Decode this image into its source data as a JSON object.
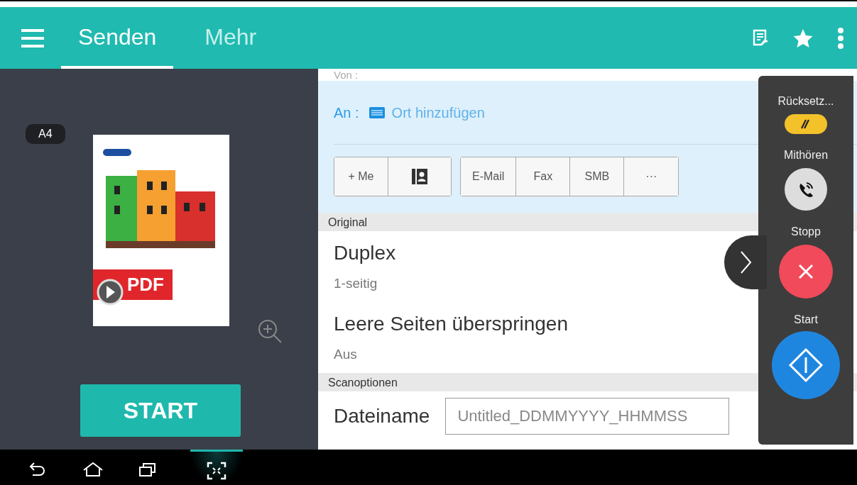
{
  "header": {
    "tabs": [
      {
        "label": "Senden",
        "selected": true
      },
      {
        "label": "Mehr",
        "selected": false
      }
    ],
    "actions": [
      {
        "kind": "document"
      },
      {
        "kind": "star"
      },
      {
        "kind": "more"
      }
    ]
  },
  "preview": {
    "paper_size": "A4",
    "format_badge": "PDF",
    "start_button": "START"
  },
  "form": {
    "from_label": "Von :",
    "to": {
      "label": "An :",
      "link": "Ort hinzufügen"
    },
    "button_groups": [
      [
        {
          "kind": "text",
          "label": "+ Me"
        },
        {
          "kind": "contacts"
        }
      ],
      [
        {
          "kind": "text",
          "label": "E-Mail"
        },
        {
          "kind": "text",
          "label": "Fax"
        },
        {
          "kind": "text",
          "label": "SMB"
        },
        {
          "kind": "text",
          "label": "···"
        }
      ]
    ],
    "sections": [
      {
        "title": "Original",
        "settings": [
          {
            "kind": "option",
            "title": "Duplex",
            "value": "1-seitig"
          },
          {
            "kind": "option",
            "title": "Leere Seiten überspringen",
            "value": "Aus"
          }
        ]
      },
      {
        "title": "Scanoptionen",
        "settings": [
          {
            "kind": "field",
            "title": "Dateiname",
            "placeholder": "Untitled_DDMMYYYY_HHMMSS"
          }
        ]
      }
    ]
  },
  "side_panel": [
    {
      "kind": "reset",
      "label": "Rücksetz..."
    },
    {
      "kind": "listen",
      "label": "Mithören"
    },
    {
      "kind": "stop",
      "label": "Stopp"
    },
    {
      "kind": "start",
      "label": "Start"
    }
  ],
  "nav_bar": [
    {
      "kind": "back",
      "selected": false
    },
    {
      "kind": "home",
      "selected": false
    },
    {
      "kind": "recents",
      "selected": false
    },
    {
      "kind": "scan",
      "selected": true
    }
  ]
}
